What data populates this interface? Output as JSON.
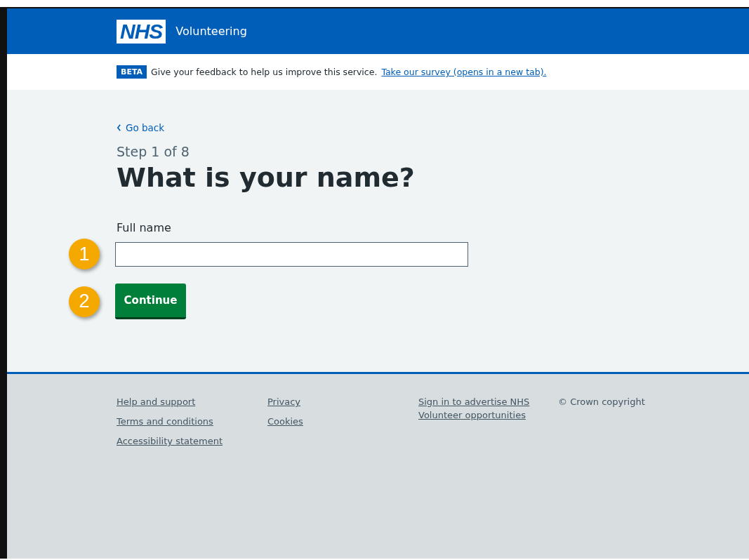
{
  "header": {
    "logo": "NHS",
    "service": "Volunteering"
  },
  "phase_banner": {
    "tag": "BETA",
    "text": "Give your feedback to help us improve this service.",
    "link": "Take our survey (opens in a new tab)."
  },
  "back_link": "Go back",
  "caption": "Step 1 of 8",
  "heading": "What is your name?",
  "field": {
    "label": "Full name",
    "callout": "1"
  },
  "button": {
    "label": "Continue",
    "callout": "2"
  },
  "footer": {
    "columns": [
      [
        "Help and support",
        "Terms and conditions",
        "Accessibility statement"
      ],
      [
        "Privacy",
        "Cookies"
      ],
      [
        "Sign in to advertise NHS Volunteer opportunities"
      ]
    ],
    "copyright": "© Crown copyright"
  }
}
